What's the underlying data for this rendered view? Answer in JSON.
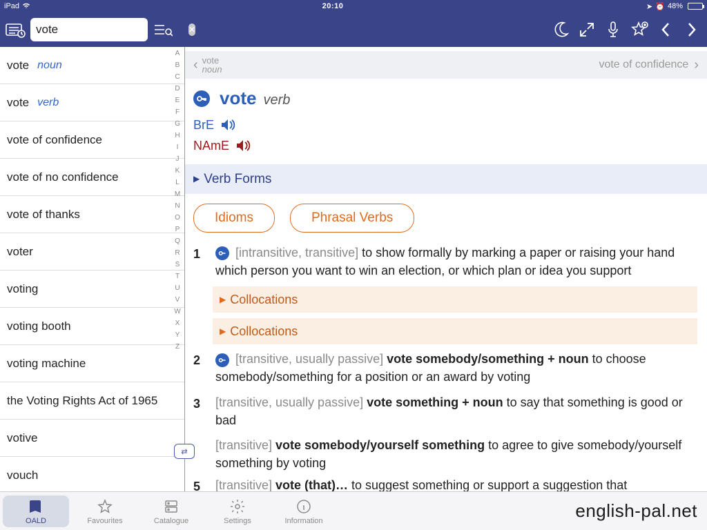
{
  "status": {
    "device": "iPad",
    "time": "20:10",
    "battery": "48%"
  },
  "search": {
    "value": "vote"
  },
  "results": [
    {
      "w": "vote",
      "pos": "noun"
    },
    {
      "w": "vote",
      "pos": "verb"
    },
    {
      "w": "vote of confidence",
      "pos": ""
    },
    {
      "w": "vote of no confidence",
      "pos": ""
    },
    {
      "w": "vote of thanks",
      "pos": ""
    },
    {
      "w": "voter",
      "pos": ""
    },
    {
      "w": "voting",
      "pos": ""
    },
    {
      "w": "voting booth",
      "pos": ""
    },
    {
      "w": "voting machine",
      "pos": ""
    },
    {
      "w": "the Voting Rights Act of 1965",
      "pos": ""
    },
    {
      "w": "votive",
      "pos": ""
    },
    {
      "w": "vouch",
      "pos": ""
    }
  ],
  "index": [
    "A",
    "B",
    "C",
    "D",
    "E",
    "F",
    "G",
    "H",
    "I",
    "J",
    "K",
    "L",
    "M",
    "N",
    "O",
    "P",
    "Q",
    "R",
    "S",
    "T",
    "U",
    "V",
    "W",
    "X",
    "Y",
    "Z"
  ],
  "pager": {
    "prev_word": "vote",
    "prev_pos": "noun",
    "next": "vote of confidence"
  },
  "entry": {
    "headword": "vote",
    "pos": "verb",
    "bre": "BrE",
    "name": "NAmE",
    "section": "Verb Forms",
    "pills": {
      "idioms": "Idioms",
      "phrasal": "Phrasal Verbs"
    },
    "colloc": "Collocations",
    "senses": {
      "s1_gram": "[intransitive, transitive]",
      "s1_def": " to show formally by marking a paper or raising your hand which person you want to win an election, or which plan or idea you support",
      "s2_gram": "[transitive, usually passive]",
      "s2_patt": " vote somebody/something + noun",
      "s2_def": " to choose somebody/something for a position or an award by voting",
      "s3_gram": "[transitive, usually passive]",
      "s3_patt": " vote something + noun",
      "s3_def": " to say that something is good or bad",
      "s4_gram": "[transitive]",
      "s4_patt": " vote somebody/yourself something",
      "s4_def": " to agree to give somebody/yourself something by voting",
      "s5_gram": "[transitive]",
      "s5_patt": " vote (that)…",
      "s5_def": " to suggest something or support a suggestion that"
    }
  },
  "tabs": {
    "oald": "OALD",
    "fav": "Favourites",
    "cat": "Catalogue",
    "set": "Settings",
    "info": "Information"
  },
  "watermark": "english-pal.net"
}
